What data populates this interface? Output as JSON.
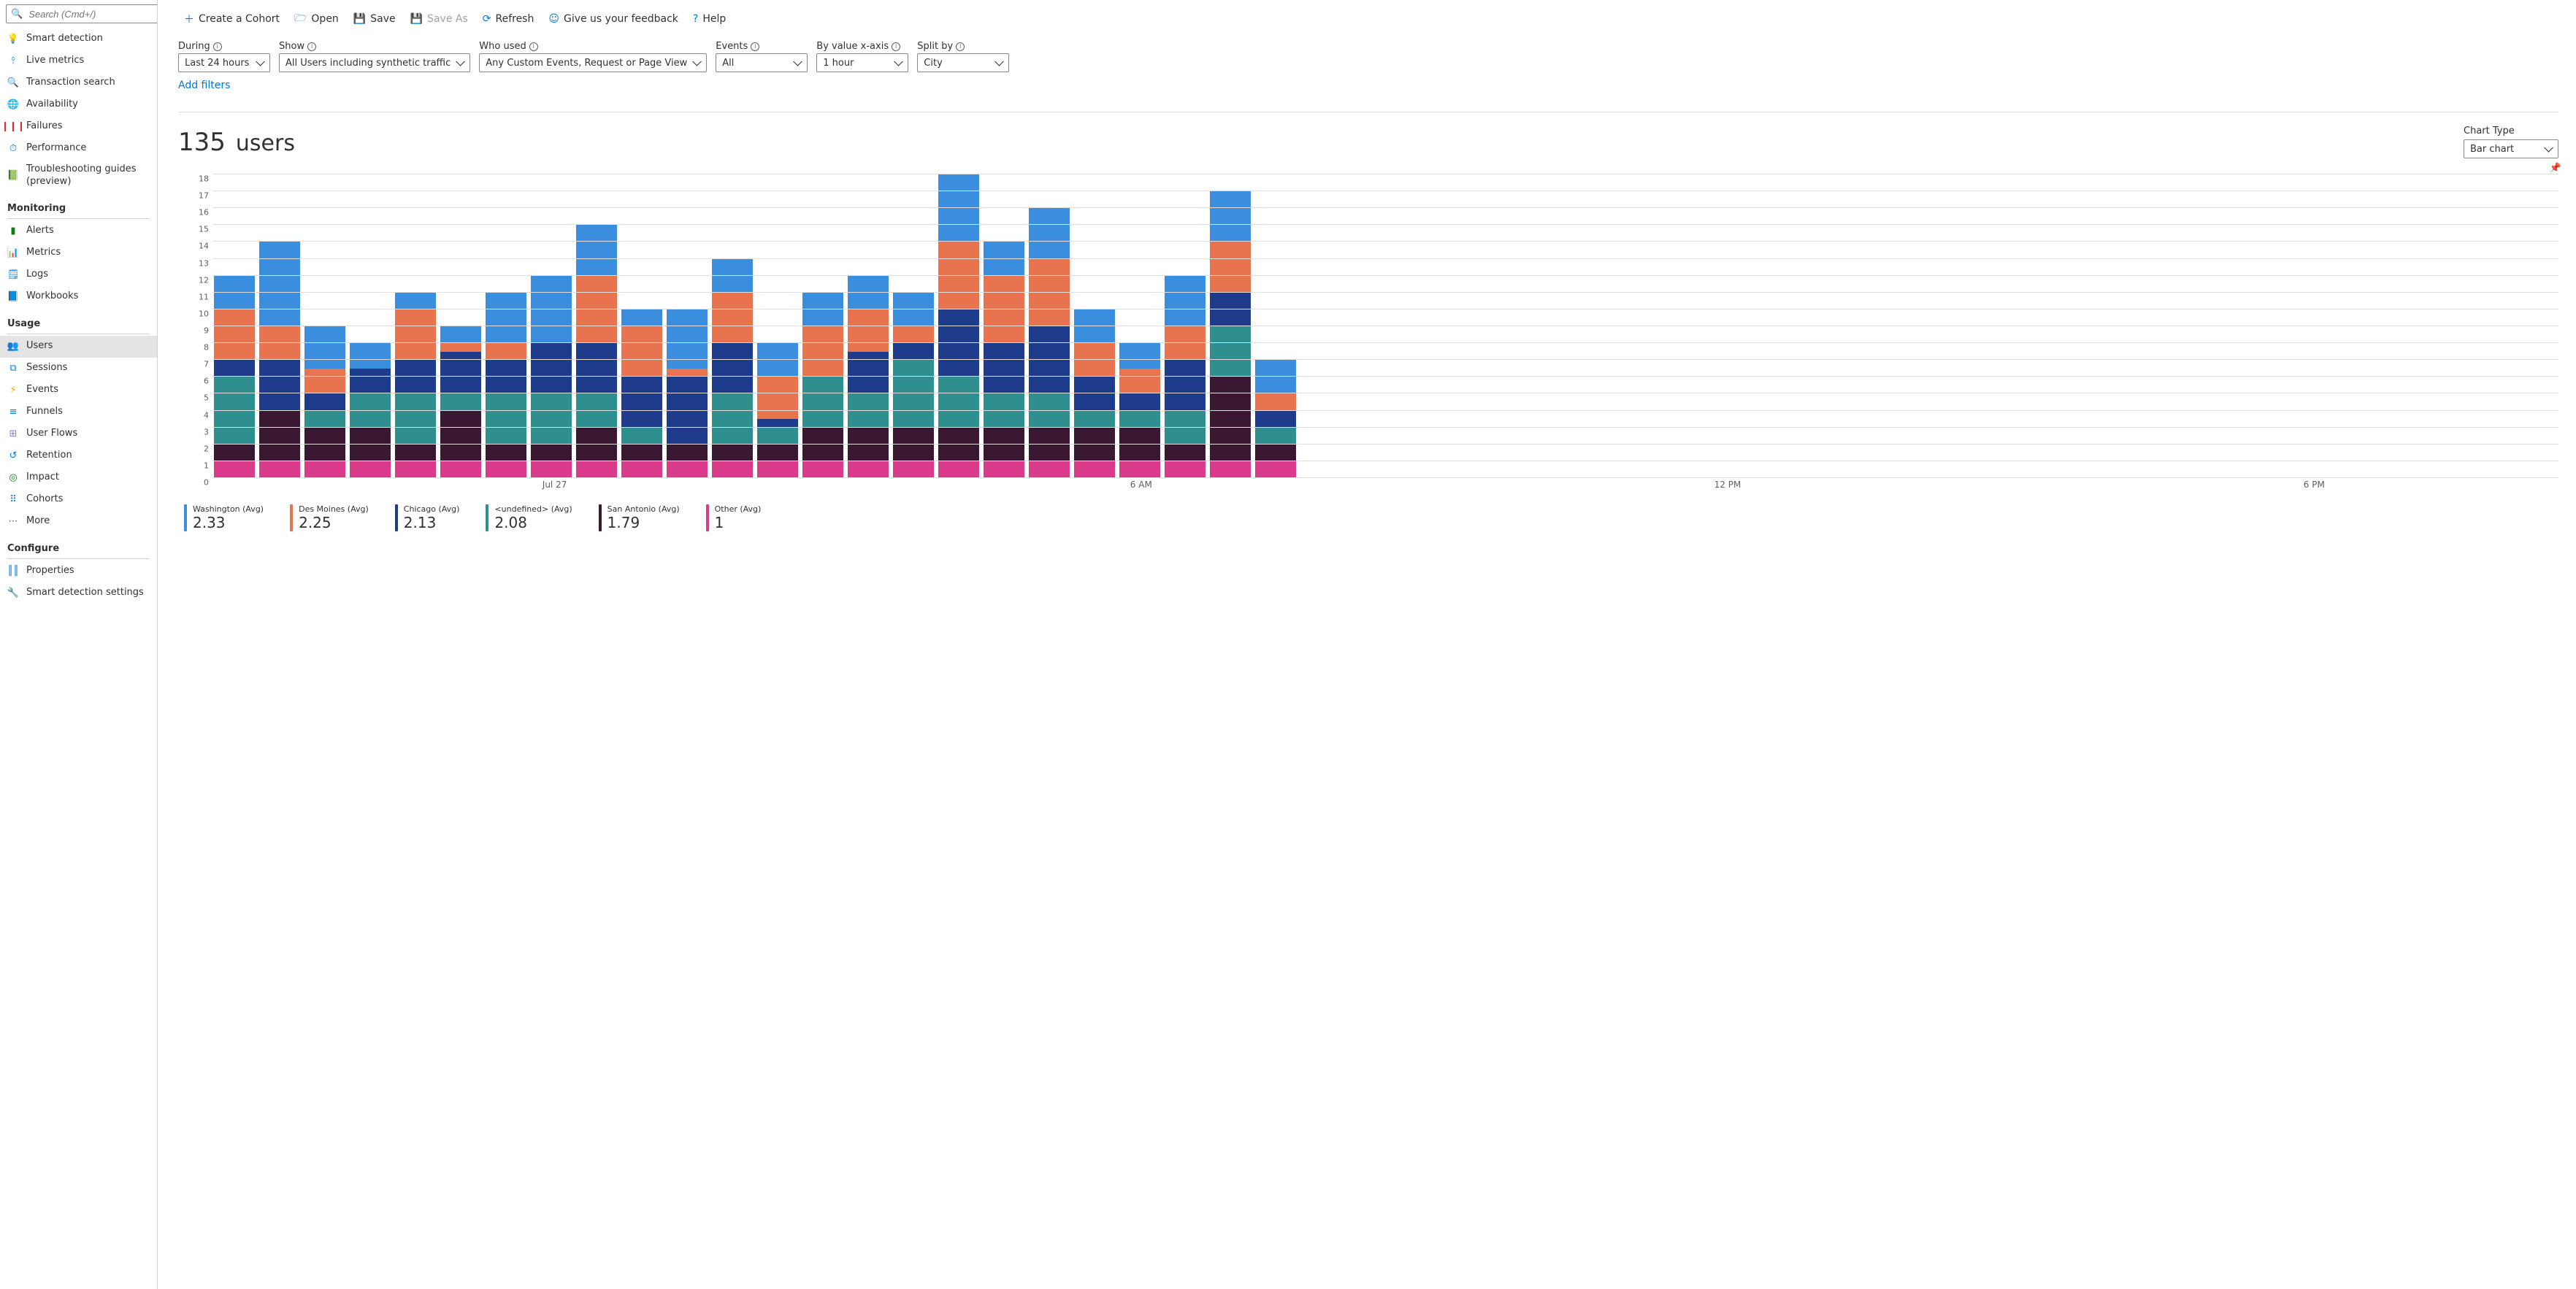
{
  "search": {
    "placeholder": "Search (Cmd+/)"
  },
  "sidebar": {
    "items_investigate": [
      {
        "label": "Smart detection",
        "glyph": "💡",
        "color": "#f2c811"
      },
      {
        "label": "Live metrics",
        "glyph": "⫯",
        "color": "#0078d4"
      },
      {
        "label": "Transaction search",
        "glyph": "🔍",
        "color": "#0078d4"
      },
      {
        "label": "Availability",
        "glyph": "🌐",
        "color": "#0078d4"
      },
      {
        "label": "Failures",
        "glyph": "❙❙❙",
        "color": "#d13438"
      },
      {
        "label": "Performance",
        "glyph": "⏱",
        "color": "#0078d4"
      },
      {
        "label": "Troubleshooting guides (preview)",
        "glyph": "📗",
        "color": "#107c10"
      }
    ],
    "section_monitoring": "Monitoring",
    "items_monitoring": [
      {
        "label": "Alerts",
        "glyph": "▮",
        "color": "#107c10"
      },
      {
        "label": "Metrics",
        "glyph": "📊",
        "color": "#0078d4"
      },
      {
        "label": "Logs",
        "glyph": "🗒",
        "color": "#0078d4"
      },
      {
        "label": "Workbooks",
        "glyph": "📘",
        "color": "#0078d4"
      }
    ],
    "section_usage": "Usage",
    "items_usage": [
      {
        "label": "Users",
        "selected": true,
        "glyph": "👥",
        "color": "#0078d4"
      },
      {
        "label": "Sessions",
        "glyph": "⧉",
        "color": "#0078d4"
      },
      {
        "label": "Events",
        "glyph": "⚡",
        "color": "#f7a300"
      },
      {
        "label": "Funnels",
        "glyph": "≡",
        "color": "#0078d4"
      },
      {
        "label": "User Flows",
        "glyph": "⊞",
        "color": "#8378de"
      },
      {
        "label": "Retention",
        "glyph": "↺",
        "color": "#0078d4"
      },
      {
        "label": "Impact",
        "glyph": "◎",
        "color": "#107c10"
      },
      {
        "label": "Cohorts",
        "glyph": "⠿",
        "color": "#0078d4"
      },
      {
        "label": "More",
        "glyph": "⋯",
        "color": "#605e5c"
      }
    ],
    "section_configure": "Configure",
    "items_configure": [
      {
        "label": "Properties",
        "glyph": "║║",
        "color": "#0078d4"
      },
      {
        "label": "Smart detection settings",
        "glyph": "🔧",
        "color": "#605e5c"
      }
    ]
  },
  "toolbar": {
    "create_cohort": "Create a Cohort",
    "open": "Open",
    "save": "Save",
    "save_as": "Save As",
    "refresh": "Refresh",
    "feedback": "Give us your feedback",
    "help": "Help"
  },
  "filters": {
    "during_label": "During",
    "during_value": "Last 24 hours",
    "show_label": "Show",
    "show_value": "All Users including synthetic traffic",
    "who_label": "Who used",
    "who_value": "Any Custom Events, Request or Page View",
    "events_label": "Events",
    "events_value": "All",
    "xaxis_label": "By value x-axis",
    "xaxis_value": "1 hour",
    "split_label": "Split by",
    "split_value": "City",
    "add_filters": "Add filters"
  },
  "headline": {
    "value": "135",
    "unit": "users"
  },
  "chart_type": {
    "label": "Chart Type",
    "value": "Bar chart"
  },
  "chart_data": {
    "type": "bar",
    "ylim": [
      0,
      18
    ],
    "yticks": [
      0,
      1,
      2,
      3,
      4,
      5,
      6,
      7,
      8,
      9,
      10,
      11,
      12,
      13,
      14,
      15,
      16,
      17,
      18
    ],
    "x_labels": [
      {
        "index": 3,
        "text": "Jul 27"
      },
      {
        "index": 9,
        "text": "6 AM"
      },
      {
        "index": 15,
        "text": "12 PM"
      },
      {
        "index": 21,
        "text": "6 PM"
      }
    ],
    "colors": {
      "washington": "#3b8ede",
      "des_moines": "#e8744f",
      "chicago": "#1f3b8c",
      "undefined_": "#2f8f8f",
      "san_antonio": "#3a1832",
      "other": "#d93a8a"
    },
    "series_order": [
      "other",
      "san_antonio",
      "undefined_",
      "chicago",
      "des_moines",
      "washington"
    ],
    "series_names": {
      "washington": "Washington (Avg)",
      "des_moines": "Des Moines (Avg)",
      "chicago": "Chicago (Avg)",
      "undefined_": "<undefined> (Avg)",
      "san_antonio": "San Antonio (Avg)",
      "other": "Other (Avg)"
    },
    "columns": [
      {
        "other": 1,
        "san_antonio": 1,
        "undefined_": 4,
        "chicago": 1,
        "des_moines": 3,
        "washington": 2
      },
      {
        "other": 1,
        "san_antonio": 3,
        "undefined_": 0,
        "chicago": 3,
        "des_moines": 2,
        "washington": 5
      },
      {
        "other": 1,
        "san_antonio": 2,
        "undefined_": 1,
        "chicago": 1,
        "des_moines": 1.5,
        "washington": 2.5
      },
      {
        "other": 1,
        "san_antonio": 2,
        "undefined_": 2,
        "chicago": 1.5,
        "des_moines": 0,
        "washington": 1.5
      },
      {
        "other": 1,
        "san_antonio": 1,
        "undefined_": 3,
        "chicago": 2,
        "des_moines": 3,
        "washington": 1
      },
      {
        "other": 1,
        "san_antonio": 3,
        "undefined_": 1,
        "chicago": 2.5,
        "des_moines": 0.5,
        "washington": 1
      },
      {
        "other": 1,
        "san_antonio": 1,
        "undefined_": 3,
        "chicago": 2,
        "des_moines": 1,
        "washington": 3
      },
      {
        "other": 1,
        "san_antonio": 1,
        "undefined_": 3,
        "chicago": 3,
        "des_moines": 0,
        "washington": 4
      },
      {
        "other": 1,
        "san_antonio": 2,
        "undefined_": 2,
        "chicago": 3,
        "des_moines": 4,
        "washington": 3
      },
      {
        "other": 1,
        "san_antonio": 1,
        "undefined_": 1,
        "chicago": 3,
        "des_moines": 3,
        "washington": 1
      },
      {
        "other": 1,
        "san_antonio": 1,
        "undefined_": 0,
        "chicago": 4,
        "des_moines": 0.5,
        "washington": 3.5
      },
      {
        "other": 1,
        "san_antonio": 1,
        "undefined_": 3,
        "chicago": 3,
        "des_moines": 3,
        "washington": 2
      },
      {
        "other": 1,
        "san_antonio": 1,
        "undefined_": 1,
        "chicago": 0.5,
        "des_moines": 2.5,
        "washington": 2
      },
      {
        "other": 1,
        "san_antonio": 2,
        "undefined_": 3,
        "chicago": 0,
        "des_moines": 3,
        "washington": 2
      },
      {
        "other": 1,
        "san_antonio": 2,
        "undefined_": 2,
        "chicago": 2.5,
        "des_moines": 2.5,
        "washington": 2
      },
      {
        "other": 1,
        "san_antonio": 2,
        "undefined_": 4,
        "chicago": 1,
        "des_moines": 1,
        "washington": 2
      },
      {
        "other": 1,
        "san_antonio": 2,
        "undefined_": 3,
        "chicago": 4,
        "des_moines": 4,
        "washington": 4
      },
      {
        "other": 1,
        "san_antonio": 2,
        "undefined_": 2,
        "chicago": 3,
        "des_moines": 4,
        "washington": 2
      },
      {
        "other": 1,
        "san_antonio": 2,
        "undefined_": 2,
        "chicago": 4,
        "des_moines": 4,
        "washington": 3
      },
      {
        "other": 1,
        "san_antonio": 2,
        "undefined_": 1,
        "chicago": 2,
        "des_moines": 2,
        "washington": 2
      },
      {
        "other": 1,
        "san_antonio": 2,
        "undefined_": 1,
        "chicago": 1,
        "des_moines": 1.5,
        "washington": 1.5
      },
      {
        "other": 1,
        "san_antonio": 1,
        "undefined_": 2,
        "chicago": 3,
        "des_moines": 2,
        "washington": 3
      },
      {
        "other": 1,
        "san_antonio": 5,
        "undefined_": 3,
        "chicago": 2,
        "des_moines": 3,
        "washington": 3
      },
      {
        "other": 1,
        "san_antonio": 1,
        "undefined_": 1,
        "chicago": 1,
        "des_moines": 1,
        "washington": 2
      }
    ]
  },
  "legend": [
    {
      "key": "washington",
      "value": "2.33"
    },
    {
      "key": "des_moines",
      "value": "2.25"
    },
    {
      "key": "chicago",
      "value": "2.13"
    },
    {
      "key": "undefined_",
      "value": "2.08"
    },
    {
      "key": "san_antonio",
      "value": "1.79"
    },
    {
      "key": "other",
      "value": "1"
    }
  ]
}
